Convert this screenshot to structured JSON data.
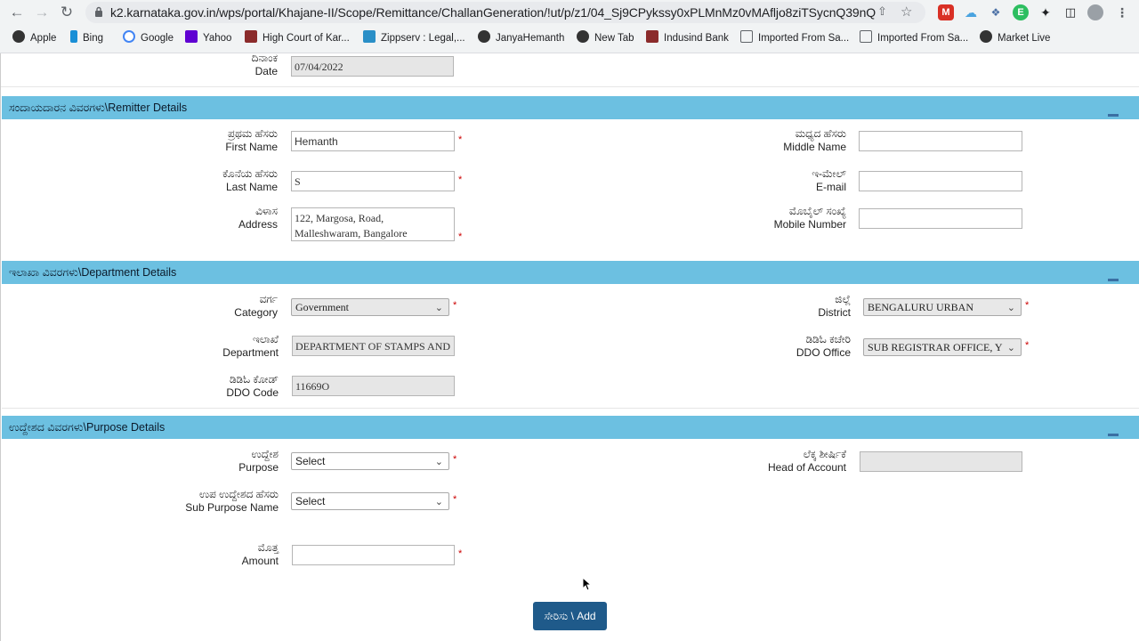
{
  "browser": {
    "url": "k2.karnataka.gov.in/wps/portal/Khajane-II/Scope/Remittance/ChallanGeneration/!ut/p/z1/04_Sj9CPykssy0xPLMnMz0vMAfljo8ziTSycnQ39nQ38...",
    "bookmarks": [
      "Apple",
      "Bing",
      "Google",
      "Yahoo",
      "High Court of Kar...",
      "Zippserv : Legal,...",
      "JanyaHemanth",
      "New Tab",
      "Indusind Bank",
      "Imported From Sa...",
      "Imported From Sa...",
      "Market Live"
    ],
    "colors": {
      "chrome": "#f1f3f4",
      "url_bar": "#e8eaed"
    }
  },
  "date_row": {
    "label_kn": "ದಿನಾಂಕ",
    "label_en": "Date",
    "value": "07/04/2022"
  },
  "remitter": {
    "title": "ಸಂದಾಯದಾರನ ವಿವರಗಳು\\Remitter Details",
    "first_name": {
      "label_kn": "ಪ್ರಥಮ ಹೆಸರು",
      "label_en": "First Name",
      "value": "Hemanth"
    },
    "middle_name": {
      "label_kn": "ಮಧ್ಯದ ಹೆಸರು",
      "label_en": "Middle Name",
      "value": ""
    },
    "last_name": {
      "label_kn": "ಕೊನೆಯ ಹೆಸರು",
      "label_en": "Last Name",
      "value": "S"
    },
    "email": {
      "label_kn": "ಇ-ಮೇಲ್",
      "label_en": "E-mail",
      "value": ""
    },
    "address": {
      "label_kn": "ವಿಳಾಸ",
      "label_en": "Address",
      "line1": "122, Margosa, Road,",
      "line2": "Malleshwaram, Bangalore"
    },
    "mobile": {
      "label_kn": "ಮೊಬೈಲ್ ಸಂಖ್ಯೆ",
      "label_en": "Mobile Number",
      "value": ""
    }
  },
  "department": {
    "title": "ಇಲಾಖಾ ವಿವರಗಳು\\Department Details",
    "category": {
      "label_kn": "ವರ್ಗ",
      "label_en": "Category",
      "value": "Government"
    },
    "district": {
      "label_kn": "ಜಿಲ್ಲೆ",
      "label_en": "District",
      "value": "BENGALURU URBAN"
    },
    "department": {
      "label_kn": "ಇಲಾಖೆ",
      "label_en": "Department",
      "value": "DEPARTMENT OF STAMPS AND"
    },
    "ddo_office": {
      "label_kn": "ಡಿಡಿಓ ಕಚೇರಿ",
      "label_en": "DDO Office",
      "value": "SUB REGISTRAR OFFICE, Y"
    },
    "ddo_code": {
      "label_kn": "ಡಿಡಿಓ ಕೋಡ್",
      "label_en": "DDO Code",
      "value": "11669O"
    }
  },
  "purpose": {
    "title": "ಉದ್ದೇಶದ ವಿವರಗಳು\\Purpose Details",
    "purpose": {
      "label_kn": "ಉದ್ದೇಶ",
      "label_en": "Purpose",
      "value": "Select"
    },
    "head_of_account": {
      "label_kn": "ಲೆಕ್ಕ ಶೀರ್ಷಿಕೆ",
      "label_en": "Head of Account",
      "value": ""
    },
    "sub_purpose": {
      "label_kn": "ಉಪ ಉದ್ದೇಶದ ಹೆಸರು",
      "label_en": "Sub Purpose Name",
      "value": "Select"
    },
    "amount": {
      "label_kn": "ಮೊತ್ತ",
      "label_en": "Amount",
      "value": ""
    }
  },
  "add_button": "ಸೇರಿಸು \\ Add",
  "required_mark": "*",
  "colors": {
    "section_header": "#6cc0e1",
    "button": "#1f5a8a",
    "required": "#cc0000"
  }
}
